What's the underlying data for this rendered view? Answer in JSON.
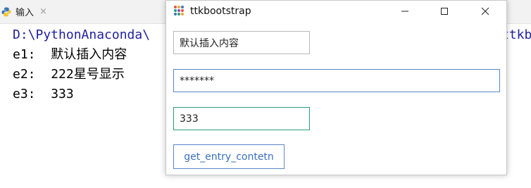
{
  "ide": {
    "tab_label": "输入",
    "tab_close": "×",
    "console_lines": [
      {
        "prefix": "D:\\PythonAnaconda\\",
        "text": ""
      },
      {
        "prefix": "e1:",
        "text": "默认插入内容"
      },
      {
        "prefix": "e2:",
        "text": "222星号显示"
      },
      {
        "prefix": "e3:",
        "text": "333"
      }
    ],
    "console_right_fragment": "ttkb"
  },
  "window": {
    "title": "ttkbootstrap",
    "entries": {
      "e1_value": "默认插入内容",
      "e2_value": "*******",
      "e3_value": "333"
    },
    "button_label": "get_entry_contetn"
  },
  "colors": {
    "e2_border": "#5a86c8",
    "e3_border": "#2b9d7d",
    "button_text": "#3a6fbf",
    "path_text": "#1f1f9f"
  }
}
